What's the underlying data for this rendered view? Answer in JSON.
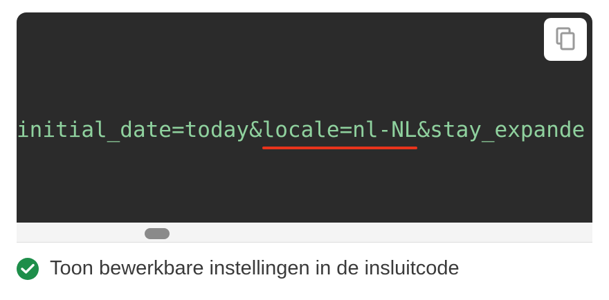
{
  "code": {
    "prefix": "initial_date=today&",
    "highlighted": "locale=nl-NL",
    "suffix": "&stay_expande"
  },
  "copy_button": {
    "icon": "copy-icon"
  },
  "option": {
    "checked": true,
    "label": "Toon bewerkbare instellingen in de insluitcode"
  },
  "colors": {
    "code_background": "#2b2b2b",
    "code_text": "#8fd19e",
    "highlight_underline": "#e8341c",
    "checkbox": "#1e8e4a"
  }
}
